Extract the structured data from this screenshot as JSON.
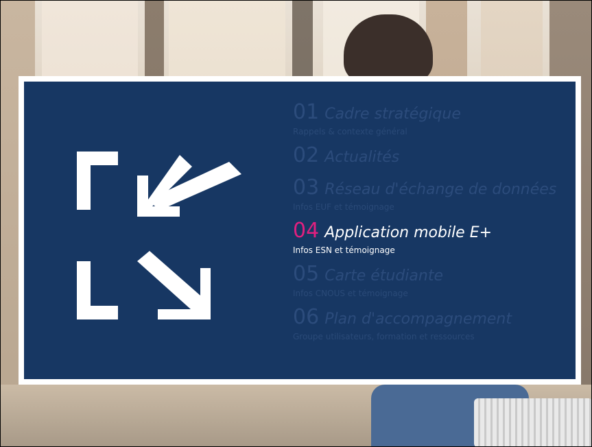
{
  "agenda": {
    "items": [
      {
        "number": "01",
        "title": "Cadre stratégique",
        "subtitle": "Rappels & contexte général",
        "active": false
      },
      {
        "number": "02",
        "title": "Actualités",
        "subtitle": "",
        "active": false
      },
      {
        "number": "03",
        "title": "Réseau d'échange de données",
        "subtitle": "Infos EUF et témoignage",
        "active": false
      },
      {
        "number": "04",
        "title": "Application mobile E+",
        "subtitle": "Infos ESN et témoignage",
        "active": true
      },
      {
        "number": "05",
        "title": "Carte étudiante",
        "subtitle": "Infos CNOUS et témoignage",
        "active": false
      },
      {
        "number": "06",
        "title": "Plan d'accompagnement",
        "subtitle": "Groupe utilisateurs, formation et ressources",
        "active": false
      }
    ]
  },
  "colors": {
    "panel_bg": "#173763",
    "inactive_text": "#2c4c7c",
    "active_number": "#e0207f",
    "active_text": "#ffffff",
    "logo": "#ffffff"
  },
  "icons": {
    "logo": "arrows-in-corners-icon"
  }
}
